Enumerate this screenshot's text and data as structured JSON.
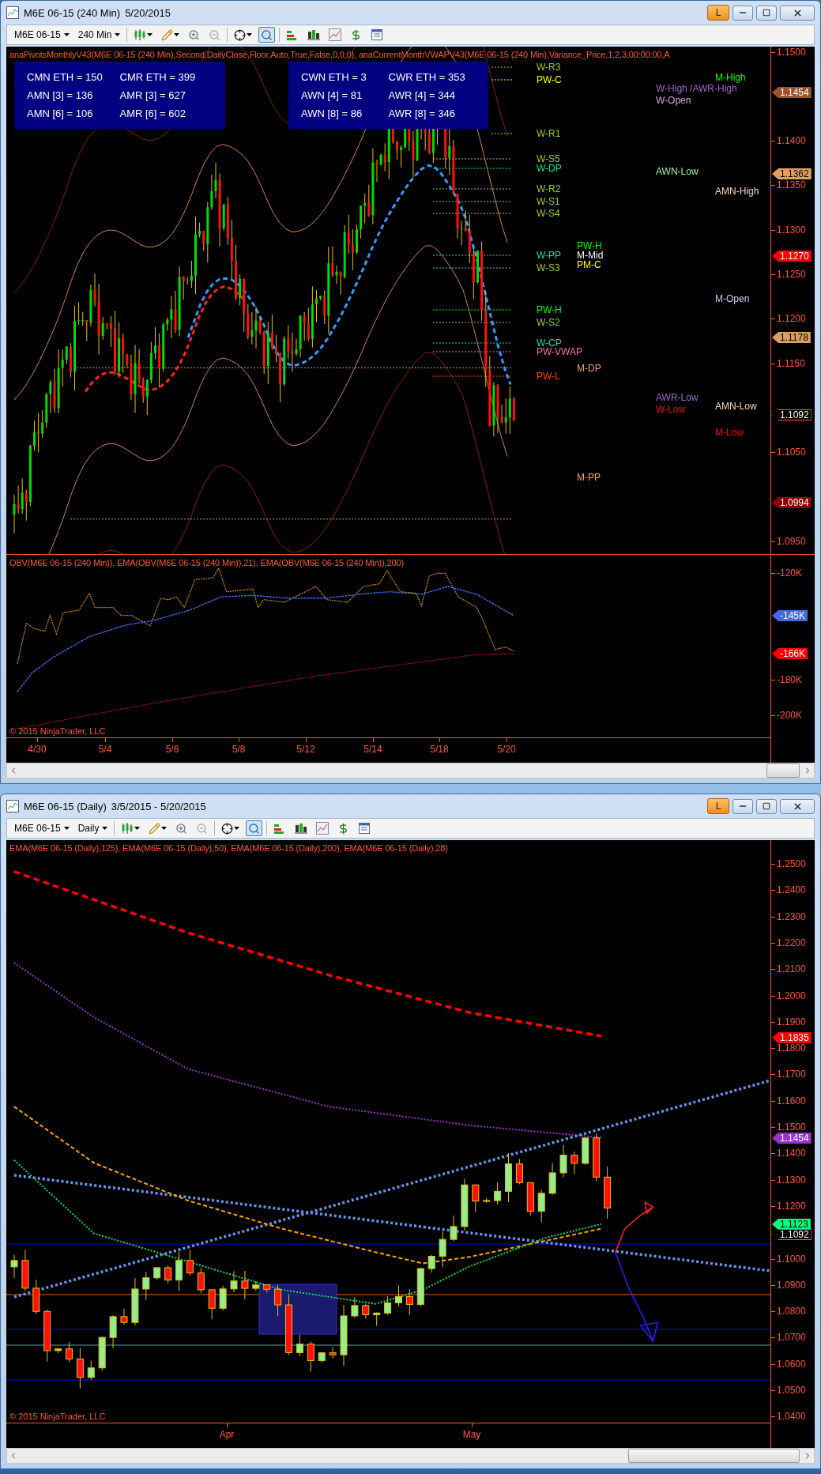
{
  "windows": [
    {
      "title": "M6E 06-15 (240 Min)",
      "date_range": "5/20/2015",
      "badge": "L",
      "toolbar": {
        "instrument": "M6E 06-15",
        "interval": "240 Min",
        "tools": [
          {
            "kind": "bars",
            "selected": false
          },
          {
            "kind": "draw",
            "selected": false
          },
          {
            "kind": "zoom-in",
            "selected": false
          },
          {
            "kind": "zoom-out",
            "selected": false
          },
          {
            "kind": "crosshair",
            "selected": false
          },
          {
            "kind": "magnifier",
            "selected": true
          },
          {
            "kind": "strategy",
            "selected": false
          },
          {
            "kind": "bar-chart",
            "selected": false
          },
          {
            "kind": "line-chart",
            "selected": false
          },
          {
            "kind": "dollar",
            "selected": false
          },
          {
            "kind": "panel",
            "selected": false
          }
        ]
      },
      "panels": [
        {
          "kind": "intraday-price",
          "indicator": "anaPivotsMonthlyV43(M6E 06-15 (240 Min),Second,DailyClose,Floor,Auto,True,False,0,0,0), anaCurrentMonthVWAPV43(M6E 06-15 (240 Min),Variance_Price,1,2,3,00:00:00,A",
          "info_boxes": [
            {
              "rows": [
                [
                  "CMN ETH = 150",
                  "CMR ETH = 399"
                ],
                [
                  "AMN [3] = 136",
                  "AMR [3] = 627"
                ],
                [
                  "AMN [6] = 106",
                  "AMR [6] = 602"
                ]
              ]
            },
            {
              "rows": [
                [
                  "CWN ETH = 3",
                  "CWR ETH = 353"
                ],
                [
                  "AWN [4] = 81",
                  "AWR [4] = 344"
                ],
                [
                  "AWN [8] = 86",
                  "AWR [8] = 346"
                ]
              ]
            }
          ],
          "level_labels": [
            {
              "text": "W-R3",
              "color": "#9acd32"
            },
            {
              "text": "PW-C",
              "color": "#ffff00"
            },
            {
              "text": "M-High",
              "color": "#00ff00"
            },
            {
              "text": "W-High /AWR-High",
              "color": "#9966cc"
            },
            {
              "text": "W-Open",
              "color": "#dda0dd"
            },
            {
              "text": "W-R1",
              "color": "#9acd32"
            },
            {
              "text": "W-S5",
              "color": "#9acd32"
            },
            {
              "text": "W-DP",
              "color": "#00e5a0"
            },
            {
              "text": "AWN-Low",
              "color": "#98fb98"
            },
            {
              "text": "W-R2",
              "color": "#9acd32"
            },
            {
              "text": "AMN-High",
              "color": "#ffdab9"
            },
            {
              "text": "W-S1",
              "color": "#9acd32"
            },
            {
              "text": "W-S4",
              "color": "#9acd32"
            },
            {
              "text": "W-PP",
              "color": "#00e5a0"
            },
            {
              "text": "PW-H",
              "color": "#00ff00"
            },
            {
              "text": "M-Mid",
              "color": "#ffffff"
            },
            {
              "text": "PM-C",
              "color": "#ffff00"
            },
            {
              "text": "W-S3",
              "color": "#9acd32"
            },
            {
              "text": "M-Open",
              "color": "#ccccff"
            },
            {
              "text": "PW-H",
              "color": "#00ff00"
            },
            {
              "text": "W-S2",
              "color": "#9acd32"
            },
            {
              "text": "W-CP",
              "color": "#00e5a0"
            },
            {
              "text": "PW-VWAP",
              "color": "#ff69b4"
            },
            {
              "text": "M-DP",
              "color": "#f4a460"
            },
            {
              "text": "PW-L",
              "color": "#ff4500"
            },
            {
              "text": "AWR-Low",
              "color": "#9966cc"
            },
            {
              "text": "W-Low",
              "color": "#ff0000"
            },
            {
              "text": "AMN-Low",
              "color": "#ffdab9"
            },
            {
              "text": "M-Low",
              "color": "#ff0000"
            },
            {
              "text": "M-PP",
              "color": "#f4a460"
            }
          ],
          "axis_labels": [
            "1.1500",
            "1.1400",
            "1.1350",
            "1.1300",
            "1.1250",
            "1.1200",
            "1.1150",
            "1.1050",
            "1.0950"
          ],
          "price_flags": [
            {
              "text": "1.1454",
              "color": "#a0522d"
            },
            {
              "text": "1.1362",
              "color": "#e0a060"
            },
            {
              "text": "1.1270",
              "color": "#ff0000"
            },
            {
              "text": "1.1178",
              "color": "#d9a066"
            },
            {
              "text": "1.1092",
              "color": "#000000"
            },
            {
              "text": "1.0994",
              "color": "#8b0000"
            }
          ]
        },
        {
          "kind": "obv",
          "indicator": "OBV(M6E 06-15 (240 Min)), EMA(OBV(M6E 06-15 (240 Min)),21), EMA(OBV(M6E 06-15 (240 Min)),200)",
          "axis_labels": [
            "-120K",
            "-180K",
            "-200K"
          ],
          "price_flags": [
            {
              "text": "-145K",
              "color": "#4169e1"
            },
            {
              "text": "-166K",
              "color": "#ff0000"
            }
          ],
          "copyright": "© 2015 NinjaTrader, LLC"
        }
      ],
      "time_labels": [
        "4/30",
        "5/4",
        "5/6",
        "5/8",
        "5/12",
        "5/14",
        "5/18",
        "5/20"
      ]
    },
    {
      "title": "M6E 06-15 (Daily)",
      "date_range": "3/5/2015 - 5/20/2015",
      "badge": "L",
      "toolbar": {
        "instrument": "M6E 06-15",
        "interval": "Daily",
        "tools": [
          {
            "kind": "bars",
            "selected": false
          },
          {
            "kind": "draw",
            "selected": false
          },
          {
            "kind": "zoom-in",
            "selected": false
          },
          {
            "kind": "zoom-out",
            "selected": false
          },
          {
            "kind": "crosshair",
            "selected": false
          },
          {
            "kind": "magnifier",
            "selected": true
          },
          {
            "kind": "strategy",
            "selected": false
          },
          {
            "kind": "bar-chart",
            "selected": false
          },
          {
            "kind": "line-chart",
            "selected": false
          },
          {
            "kind": "dollar",
            "selected": false
          },
          {
            "kind": "panel",
            "selected": false
          }
        ]
      },
      "panels": [
        {
          "kind": "daily-price",
          "indicator": "EMA(M6E 06-15 (Daily),125), EMA(M6E 06-15 (Daily),50), EMA(M6E 06-15 (Daily),200), EMA(M6E 06-15 (Daily),28)",
          "axis_labels": [
            "1.2500",
            "1.2400",
            "1.2300",
            "1.2200",
            "1.2100",
            "1.2000",
            "1.1900",
            "1.1800",
            "1.1700",
            "1.1600",
            "1.1500",
            "1.1400",
            "1.1300",
            "1.1200",
            "1.1000",
            "1.0900",
            "1.0800",
            "1.0700",
            "1.0600",
            "1.0500",
            "1.0400"
          ],
          "price_flags": [
            {
              "text": "1.1835",
              "color": "#ff0000"
            },
            {
              "text": "1.1454",
              "color": "#9932cc"
            },
            {
              "text": "1.1123",
              "color": "#00ff7f"
            },
            {
              "text": "1.1092",
              "color": "#000000"
            }
          ],
          "copyright": "© 2015 NinjaTrader, LLC"
        }
      ],
      "time_labels": [
        "Apr",
        "May"
      ]
    }
  ]
}
